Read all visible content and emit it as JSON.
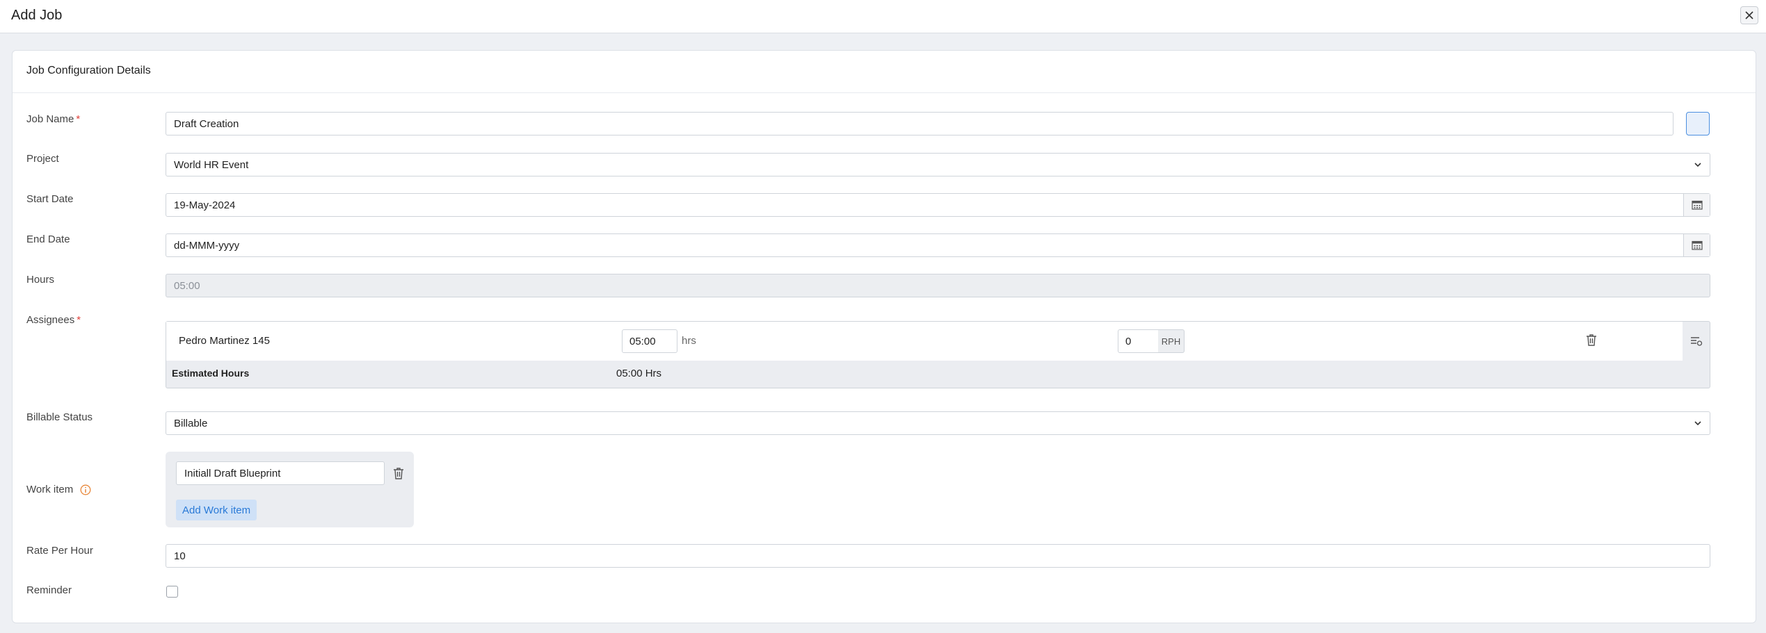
{
  "header": {
    "title": "Add Job"
  },
  "section": {
    "title": "Job Configuration Details"
  },
  "labels": {
    "job_name": "Job Name",
    "project": "Project",
    "start_date": "Start Date",
    "end_date": "End Date",
    "hours": "Hours",
    "assignees": "Assignees",
    "billable_status": "Billable Status",
    "work_item": "Work item",
    "rate_per_hour": "Rate Per Hour",
    "reminder": "Reminder",
    "required_mark": "*"
  },
  "fields": {
    "job_name": "Draft Creation",
    "project": "World HR Event",
    "start_date": "19-May-2024",
    "end_date_placeholder": "dd-MMM-yyyy",
    "hours": "05:00",
    "billable_status": "Billable",
    "rate_per_hour": "10",
    "reminder_checked": false
  },
  "assignees": [
    {
      "name": "Pedro Martinez 145",
      "hours": "05:00",
      "hours_unit": "hrs",
      "rate": "0",
      "rate_unit": "RPH"
    }
  ],
  "estimated": {
    "label": "Estimated Hours",
    "value": "05:00 Hrs"
  },
  "work_items": [
    {
      "value": "Initiall Draft Blueprint"
    }
  ],
  "work_item_add_label": "Add Work item",
  "colors": {
    "required": "#e0423c",
    "link": "#2a7ad7",
    "info": "#e8873a",
    "primary_border": "#4b8fe0"
  },
  "icons": [
    "close-icon",
    "chevron-down-icon",
    "calendar-icon",
    "trash-icon",
    "list-settings-icon",
    "info-icon"
  ]
}
